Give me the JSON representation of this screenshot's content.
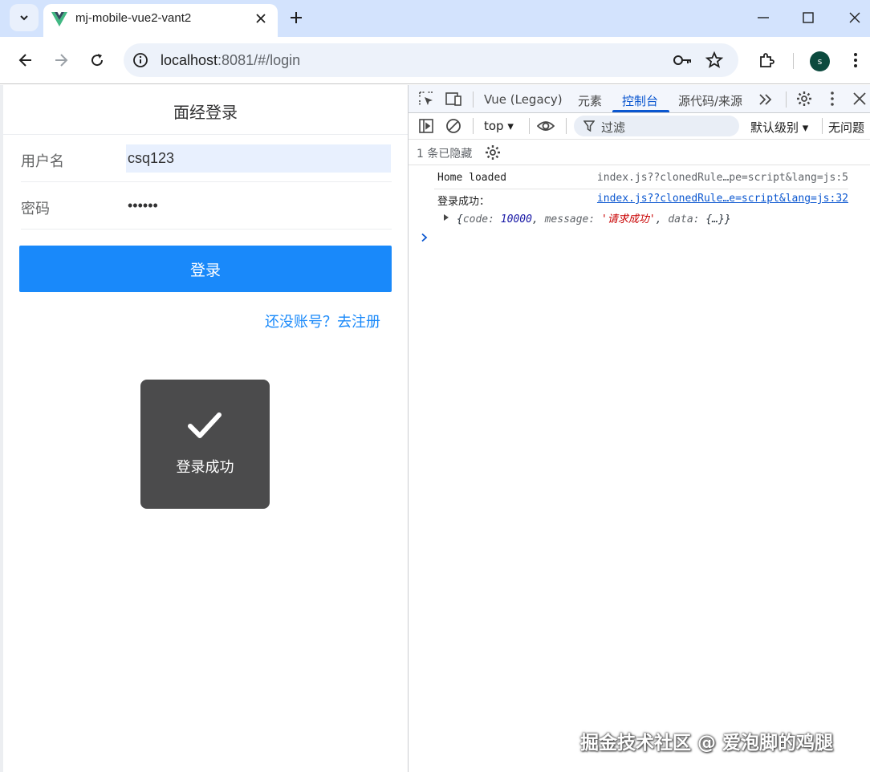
{
  "browser": {
    "tab_title": "mj-mobile-vue2-vant2",
    "url_host": "localhost",
    "url_path": ":8081/#/login",
    "profile_initial": "s"
  },
  "page": {
    "nav_title": "面经登录",
    "username_label": "用户名",
    "username_value": "csq123",
    "password_label": "密码",
    "password_value": "••••••",
    "login_button": "登录",
    "register_link": "还没账号？去注册",
    "toast_text": "登录成功"
  },
  "devtools": {
    "tabs": [
      "Vue (Legacy)",
      "元素",
      "控制台",
      "源代码/来源"
    ],
    "active_tab": "控制台",
    "context": "top ▾",
    "filter_placeholder": "过滤",
    "levels": "默认级别 ▾",
    "issues": "无问题",
    "hidden_count": "1 条已隐藏",
    "logs": [
      {
        "message": "Home loaded",
        "source": "index.js??clonedRule…pe=script&lang=js:5"
      },
      {
        "message": "登录成功：",
        "source": "index.js??clonedRule…e=script&lang=js:32"
      }
    ],
    "object_preview": {
      "open": "{",
      "code_key": "code: ",
      "code_val": "10000",
      "sep1": ", ",
      "message_key": "message: ",
      "message_val": "'请求成功'",
      "sep2": ", ",
      "data_key": "data: ",
      "data_val": "{…}",
      "close": "}"
    }
  },
  "watermark": "掘金技术社区 @ 爱泡脚的鸡腿",
  "colors": {
    "primary": "#1989fa",
    "devtools_accent": "#0b57d0",
    "tabstrip": "#d3e3fd"
  }
}
